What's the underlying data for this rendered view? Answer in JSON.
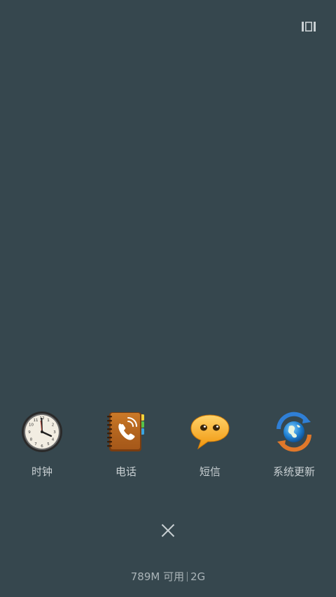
{
  "top_bar": {
    "multi_window_icon": "multi-window-icon"
  },
  "apps": [
    {
      "label": "时钟",
      "icon": "clock-icon"
    },
    {
      "label": "电话",
      "icon": "phone-book-icon"
    },
    {
      "label": "短信",
      "icon": "message-bubble-icon"
    },
    {
      "label": "系统更新",
      "icon": "globe-update-icon"
    }
  ],
  "close_icon": "close-icon",
  "memory": {
    "available": "789M 可用",
    "total": "2G"
  },
  "colors": {
    "background": "#36474e",
    "label_text": "#c9d0d3"
  }
}
